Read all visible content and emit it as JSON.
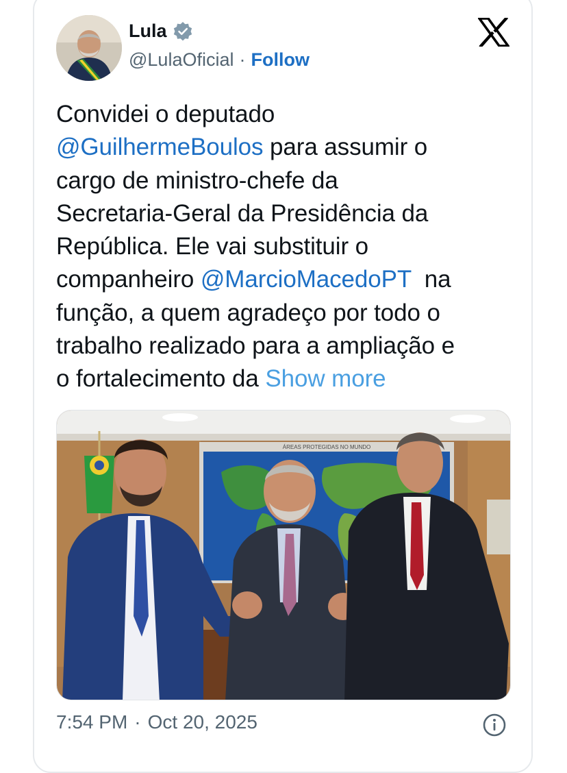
{
  "author": {
    "name": "Lula",
    "handle": "@LulaOficial",
    "separator": "·",
    "follow_label": "Follow",
    "verified_color": "#829aab"
  },
  "tweet": {
    "line1": "Convidei o deputado",
    "mention1": "@GuilhermeBoulos",
    "line2_rest": " para assumir o",
    "line3": "cargo de ministro-chefe da",
    "line4": "Secretaria-Geral da Presidência da",
    "line5": "República. Ele vai substituir o",
    "line6_start": "companheiro ",
    "mention2": "@MarcioMacedoPT",
    "line6_rest": "  na",
    "line7": "função, a quem agradeço por todo o",
    "line8": "trabalho realizado para a ampliação e",
    "line9_start": "o fortalecimento da ",
    "show_more": "Show more"
  },
  "photo": {
    "map_banner": "ÁREAS PROTEGIDAS NO MUNDO"
  },
  "footer": {
    "time": "7:54 PM",
    "separator": "·",
    "date": "Oct 20, 2025"
  },
  "icons": {
    "platform": "x-logo-icon",
    "info": "info-icon",
    "verified": "verified-badge-icon"
  },
  "colors": {
    "link": "#1d6fc4",
    "show_more": "#4a9fe1",
    "secondary_text": "#536471"
  }
}
